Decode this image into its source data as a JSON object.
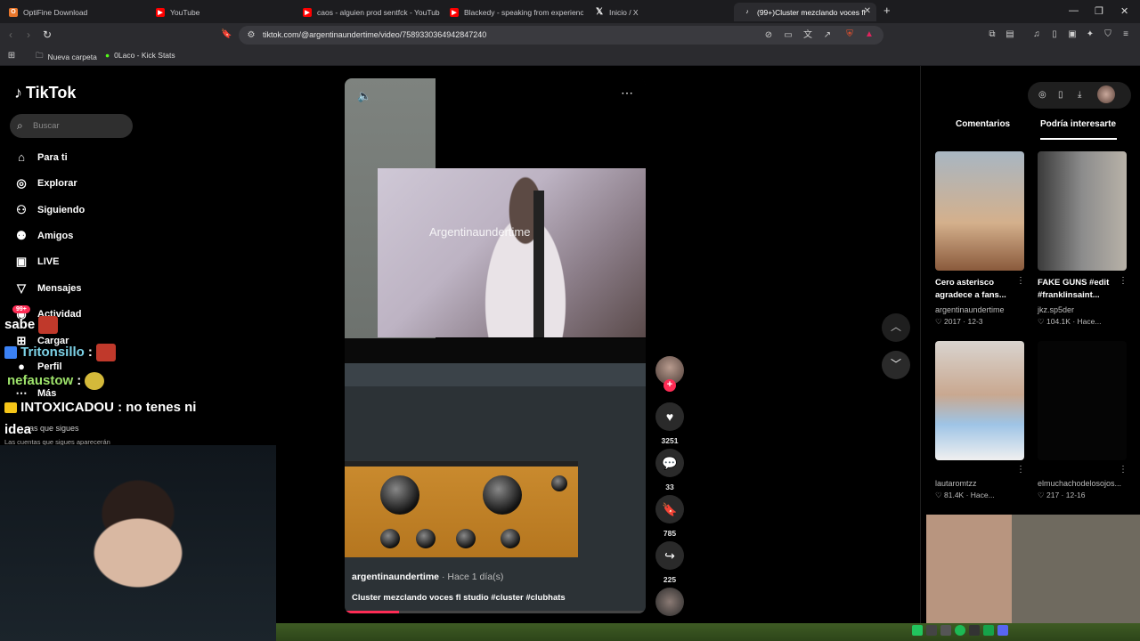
{
  "browser": {
    "tabs": [
      {
        "label": "OptiFine Download",
        "icon": "optifine-icon",
        "color": "#e8762b"
      },
      {
        "label": "YouTube",
        "icon": "youtube-icon",
        "color": "#ff0000"
      },
      {
        "label": "caos - alguien prod sentfck - YouTub",
        "icon": "youtube-icon",
        "color": "#ff0000"
      },
      {
        "label": "Blackedy - speaking from experience",
        "icon": "youtube-icon",
        "color": "#ff0000"
      },
      {
        "label": "Inicio / X",
        "icon": "x-icon",
        "color": "#000000"
      },
      {
        "label": "(99+)Cluster mezclando voces fl",
        "icon": "tiktok-icon",
        "color": "#000000"
      }
    ],
    "url": "tiktok.com/@argentinaundertime/video/7589330364942847240",
    "bookmarks": [
      {
        "label": "Nueva carpeta",
        "icon": "folder-icon"
      },
      {
        "label": "0Laco - Kick Stats",
        "icon": "kick-icon"
      }
    ]
  },
  "tiktok": {
    "logo": "TikTok",
    "search_placeholder": "Buscar",
    "nav": [
      {
        "label": "Para ti",
        "icon": "home-icon"
      },
      {
        "label": "Explorar",
        "icon": "compass-icon"
      },
      {
        "label": "Siguiendo",
        "icon": "following-icon"
      },
      {
        "label": "Amigos",
        "icon": "friends-icon"
      },
      {
        "label": "LIVE",
        "icon": "live-icon"
      },
      {
        "label": "Mensajes",
        "icon": "messages-icon"
      },
      {
        "label": "Actividad",
        "icon": "activity-icon"
      },
      {
        "label": "Cargar",
        "icon": "upload-icon"
      },
      {
        "label": "Perfil",
        "icon": "profile-icon"
      },
      {
        "label": "Más",
        "icon": "more-icon"
      }
    ],
    "activity_badge": "99+",
    "following_title": "as que sigues",
    "following_sub": "Las cuentas que sigues aparecerán",
    "video": {
      "username": "argentinaundertime",
      "time": "· Hace 1 día(s)",
      "description": "Cluster mezclando voces fl studio #cluster #clubhats",
      "watermark": "Argentinaundertime",
      "progress": 0.18
    },
    "actions": {
      "likes": "3251",
      "comments": "33",
      "saves": "785",
      "shares": "225"
    },
    "panel": {
      "tabs": [
        "Comentarios",
        "Podría interesarte"
      ],
      "videos": [
        {
          "title": "Cero asterisco agradece a fans...",
          "author": "argentinaundertime",
          "likes": "2017",
          "date": "12-3"
        },
        {
          "title": "FAKE GUNS #edit #franklinsaint...",
          "author": "jkz.sp5der",
          "likes": "104.1K",
          "date": "Hace..."
        },
        {
          "title": "",
          "author": "lautaromtzz",
          "likes": "81.4K",
          "date": "Hace..."
        },
        {
          "title": "",
          "author": "elmuchachodelosojos...",
          "likes": "217",
          "date": "12-16"
        }
      ]
    }
  },
  "stream_chat": [
    {
      "user": "sabe",
      "text": "",
      "color": "#ffffff"
    },
    {
      "user": "Tritonsillo",
      "text": ":",
      "color": "#7dd3e8"
    },
    {
      "user": "nefaustow",
      "text": ":",
      "color": "#9de26a"
    },
    {
      "user": "INTOXICADOU",
      "text": ": no tenes ni",
      "color": "#ffffff"
    },
    {
      "user": "",
      "text": "idea",
      "color": "#ffffff"
    }
  ]
}
